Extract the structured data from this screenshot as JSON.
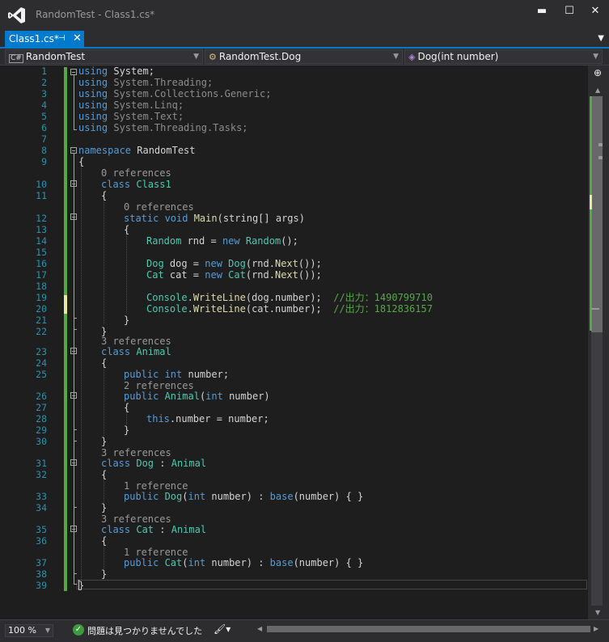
{
  "window": {
    "title": "RandomTest - Class1.cs*",
    "minimize": "▬",
    "maximize": "☐",
    "close": "✕"
  },
  "tab": {
    "label": "Class1.cs*",
    "pin": "⊣",
    "close": "✕",
    "dropdown": "▼"
  },
  "nav": {
    "project": "RandomTest",
    "project_icon": "C#",
    "class": "RandomTest.Dog",
    "class_icon": "class-icon",
    "member": "Dog(int number)",
    "member_icon": "method-icon"
  },
  "code": {
    "line_numbers": [
      "1",
      "2",
      "3",
      "4",
      "5",
      "6",
      "7",
      "8",
      "9",
      "10",
      "11",
      "12",
      "13",
      "14",
      "15",
      "16",
      "17",
      "18",
      "19",
      "20",
      "21",
      "22",
      "23",
      "24",
      "25",
      "26",
      "27",
      "28",
      "29",
      "30",
      "31",
      "32",
      "33",
      "34",
      "35",
      "36",
      "37",
      "38",
      "39"
    ],
    "usings": [
      {
        "kw": "using",
        "ns": " System;"
      },
      {
        "kw": "using",
        "ns": " System.Threading;"
      },
      {
        "kw": "using",
        "ns": " System.Collections.Generic;"
      },
      {
        "kw": "using",
        "ns": " System.Linq;"
      },
      {
        "kw": "using",
        "ns": " System.Text;"
      },
      {
        "kw": "using",
        "ns": " System.Threading.Tasks;"
      }
    ],
    "kw_namespace": "namespace",
    "ns_name": " RandomTest",
    "open_brace": "{",
    "close_brace": "}",
    "ref_0": "0 references",
    "ref_0b": "0 references",
    "kw_class": "class",
    "class1_name": " Class1",
    "kw_static_void": "static void",
    "main_name": " Main",
    "main_params": "(string[] args)",
    "random_type": "Random",
    "rnd_decl": " rnd = ",
    "kw_new": "new",
    "random_ctor": " Random",
    "random_end": "();",
    "dog_type": "Dog",
    "dog_decl": " dog = ",
    "dog_ctor": " Dog",
    "rnd_call_a": "(rnd.",
    "next_fn": "Next",
    "rnd_call_b": "());",
    "cat_type": "Cat",
    "cat_decl": " cat = ",
    "cat_ctor": " Cat",
    "console_type": "Console",
    "dot": ".",
    "writeline_fn": "WriteLine",
    "dog_arg": "(dog.number);  ",
    "dog_comment": "//出力：1490799710",
    "cat_arg": "(cat.number);  ",
    "cat_comment": "//出力：1812836157",
    "ref_3a": "3 references",
    "animal_name": " Animal",
    "kw_public_int": "public int",
    "number_field": " number;",
    "ref_2": "2 references",
    "kw_public": "public",
    "animal_ctor": " Animal",
    "int_param_open": "(",
    "kw_int": "int",
    "int_param_close": " number)",
    "kw_this": "this",
    "this_assign": ".number = number;",
    "ref_3b": "3 references",
    "dog_class": " Dog",
    "colon": " : ",
    "animal_base": "Animal",
    "ref_1a": "1 reference",
    "dog_ctor_name": " Dog",
    "ctor_tail_a": " number) : ",
    "kw_base": "base",
    "ctor_tail_b": "(number) { }",
    "ref_3c": "3 references",
    "cat_class": " Cat",
    "ref_1b": "1 reference",
    "cat_ctor_name": " Cat"
  },
  "status": {
    "zoom": "100 %",
    "ok_icon": "✓",
    "message": "問題は見つかりませんでした",
    "brush": "🖌▾",
    "scroll_left": "◀",
    "scroll_right": "▶"
  },
  "scroll": {
    "split": "⊕",
    "up": "▲",
    "down": "▼"
  },
  "colors": {
    "accent": "#007acc",
    "keyword": "#569cd6",
    "type": "#4ec9b0",
    "method": "#dcdcaa",
    "comment": "#57a64a",
    "line_number": "#2b91af"
  }
}
